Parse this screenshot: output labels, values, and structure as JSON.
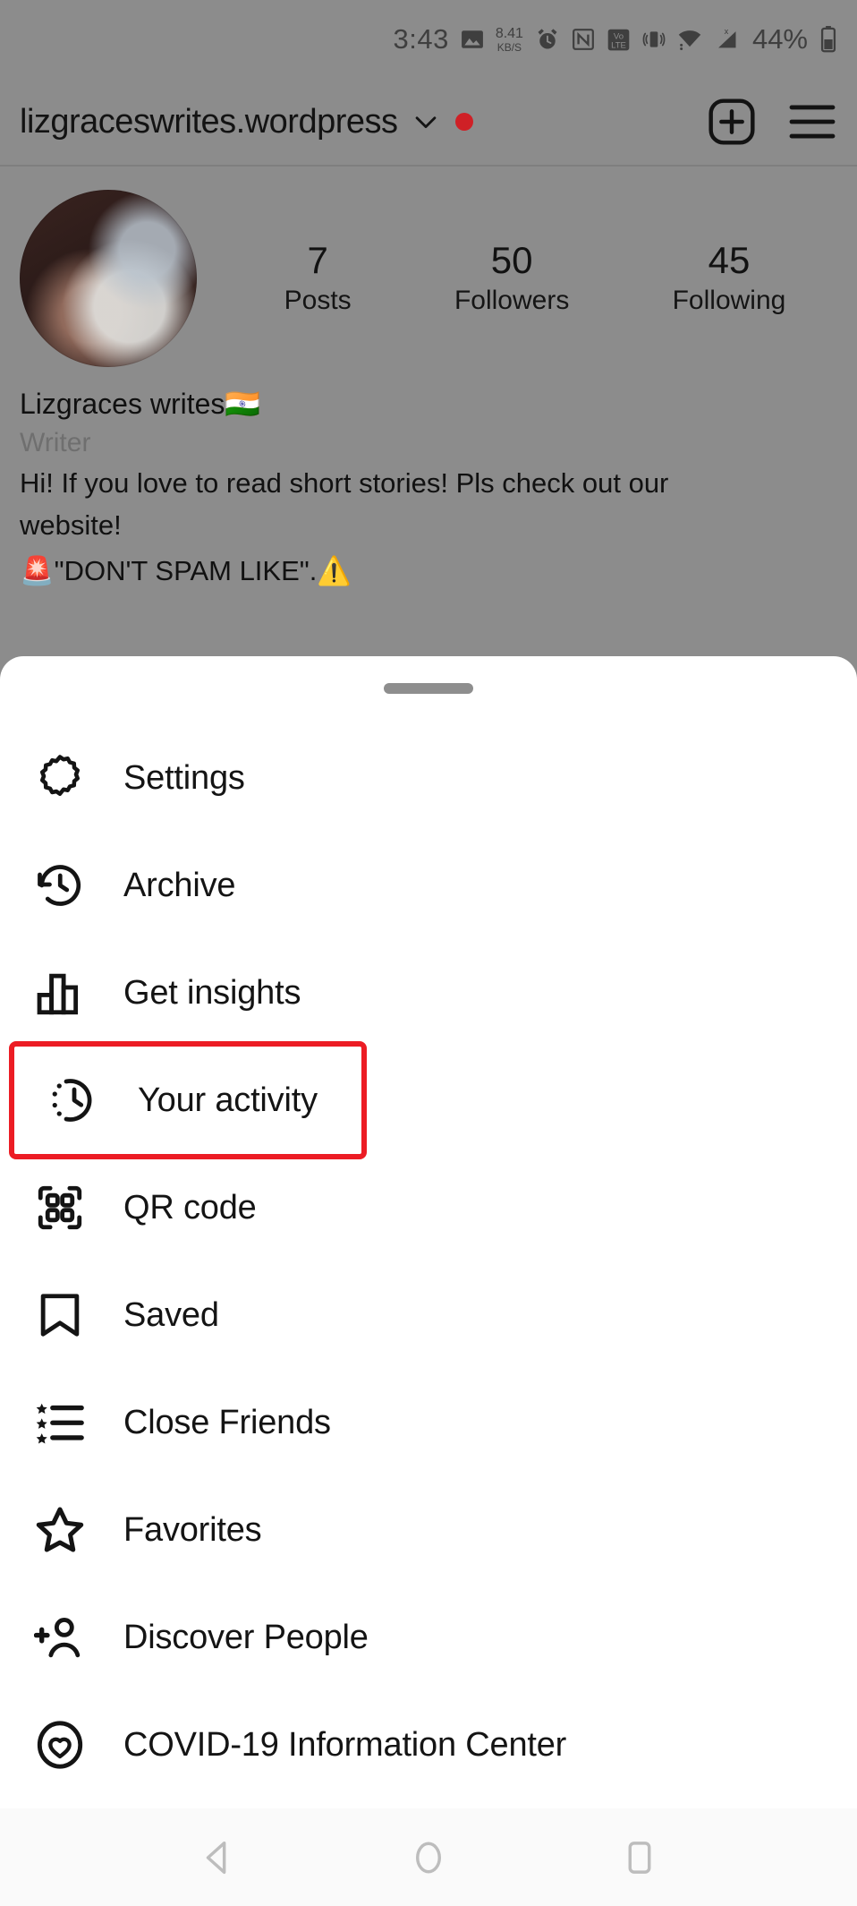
{
  "status_bar": {
    "time": "3:43",
    "network_speed": "8.41",
    "network_speed_unit": "KB/S",
    "battery_percent": "44%",
    "icons": [
      "image-icon",
      "alarm-clock-icon",
      "nfc-icon",
      "volte-icon",
      "vibrate-icon",
      "wifi-icon",
      "signal-no-sim-icon",
      "battery-icon"
    ]
  },
  "header": {
    "username": "lizgraceswrites.wordpress",
    "chevron": "chevron-down-icon",
    "status_dot_color": "#cf2026",
    "add_label": "add-post-icon",
    "menu_label": "hamburger-menu-icon"
  },
  "profile": {
    "avatar": "profile-avatar",
    "stats": [
      {
        "value": "7",
        "label": "Posts"
      },
      {
        "value": "50",
        "label": "Followers"
      },
      {
        "value": "45",
        "label": "Following"
      }
    ],
    "display_name": "Lizgraces writes🇮🇳",
    "category": "Writer",
    "bio_line1": "Hi! If you love to read short stories! Pls check out our",
    "bio_line2": "website!",
    "bio_line3": "🚨\"DON'T SPAM LIKE\".⚠️"
  },
  "sheet": {
    "handle": "drag-handle",
    "highlight_color": "#ec1c24",
    "items": [
      {
        "label": "Settings",
        "icon": "gear-icon",
        "highlighted": false
      },
      {
        "label": "Archive",
        "icon": "archive-clock-icon",
        "highlighted": false
      },
      {
        "label": "Get insights",
        "icon": "bar-chart-icon",
        "highlighted": false
      },
      {
        "label": "Your activity",
        "icon": "activity-clock-icon",
        "highlighted": true
      },
      {
        "label": "QR code",
        "icon": "qr-code-icon",
        "highlighted": false
      },
      {
        "label": "Saved",
        "icon": "bookmark-icon",
        "highlighted": false
      },
      {
        "label": "Close Friends",
        "icon": "star-list-icon",
        "highlighted": false
      },
      {
        "label": "Favorites",
        "icon": "star-icon",
        "highlighted": false
      },
      {
        "label": "Discover People",
        "icon": "add-person-icon",
        "highlighted": false
      },
      {
        "label": "COVID-19 Information Center",
        "icon": "covid-heart-icon",
        "highlighted": false
      }
    ]
  },
  "nav_bar": {
    "back": "back-triangle-icon",
    "home": "home-circle-icon",
    "recents": "recents-square-icon"
  }
}
